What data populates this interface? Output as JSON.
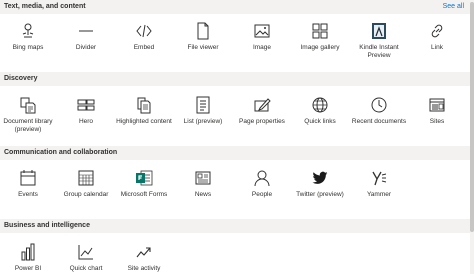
{
  "sections": [
    {
      "title": "Text, media, and content",
      "see_all": "See all",
      "items": [
        {
          "label": "Bing maps",
          "icon": "map-pin-icon"
        },
        {
          "label": "Divider",
          "icon": "divider-icon"
        },
        {
          "label": "Embed",
          "icon": "embed-code-icon"
        },
        {
          "label": "File viewer",
          "icon": "file-icon"
        },
        {
          "label": "Image",
          "icon": "image-icon"
        },
        {
          "label": "Image gallery",
          "icon": "image-gallery-icon"
        },
        {
          "label": "Kindle Instant Preview",
          "icon": "kindle-icon"
        },
        {
          "label": "Link",
          "icon": "link-icon"
        }
      ]
    },
    {
      "title": "Discovery",
      "items": [
        {
          "label": "Document library (preview)",
          "icon": "document-library-icon"
        },
        {
          "label": "Hero",
          "icon": "hero-layout-icon"
        },
        {
          "label": "Highlighted content",
          "icon": "highlighted-content-icon"
        },
        {
          "label": "List (preview)",
          "icon": "list-icon"
        },
        {
          "label": "Page properties",
          "icon": "page-properties-icon"
        },
        {
          "label": "Quick links",
          "icon": "globe-icon"
        },
        {
          "label": "Recent documents",
          "icon": "clock-icon"
        },
        {
          "label": "Sites",
          "icon": "sites-icon"
        }
      ]
    },
    {
      "title": "Communication and collaboration",
      "items": [
        {
          "label": "Events",
          "icon": "calendar-icon"
        },
        {
          "label": "Group calendar",
          "icon": "group-calendar-icon"
        },
        {
          "label": "Microsoft Forms",
          "icon": "microsoft-forms-icon"
        },
        {
          "label": "News",
          "icon": "news-icon"
        },
        {
          "label": "People",
          "icon": "person-icon"
        },
        {
          "label": "Twitter (preview)",
          "icon": "twitter-icon"
        },
        {
          "label": "Yammer",
          "icon": "yammer-icon"
        }
      ]
    },
    {
      "title": "Business and intelligence",
      "items": [
        {
          "label": "Power BI",
          "icon": "power-bi-icon"
        },
        {
          "label": "Quick chart",
          "icon": "quick-chart-icon"
        },
        {
          "label": "Site activity",
          "icon": "site-activity-icon"
        }
      ]
    }
  ],
  "colors": {
    "header_bg": "#f3f2f1",
    "text": "#323130",
    "link": "#0078d4",
    "forms_green": "#077568",
    "twitter_dark": "#1b1b1b"
  }
}
